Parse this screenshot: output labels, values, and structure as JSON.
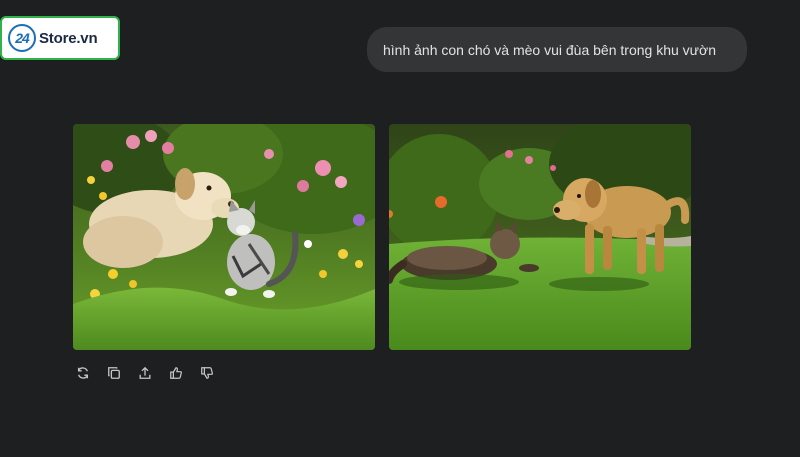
{
  "logo": {
    "badge_text": "24",
    "brand_text": "Store.vn",
    "brand_color": "#1a6fb6",
    "border_color": "#30b34a"
  },
  "prompt": {
    "text": "hình ảnh con chó và mèo vui đùa bên trong khu vườn"
  },
  "images": [
    {
      "subject": "dog-and-kitten-in-flower-garden"
    },
    {
      "subject": "golden-dog-and-cat-on-lawn"
    }
  ],
  "actions": [
    {
      "icon": "refresh-icon"
    },
    {
      "icon": "copy-icon"
    },
    {
      "icon": "share-icon"
    },
    {
      "icon": "thumbs-up-icon"
    },
    {
      "icon": "thumbs-down-icon"
    }
  ],
  "colors": {
    "background": "#1e1f20",
    "bubble": "#333537",
    "text": "#e3e3e3",
    "icon": "#c4c7c5"
  }
}
